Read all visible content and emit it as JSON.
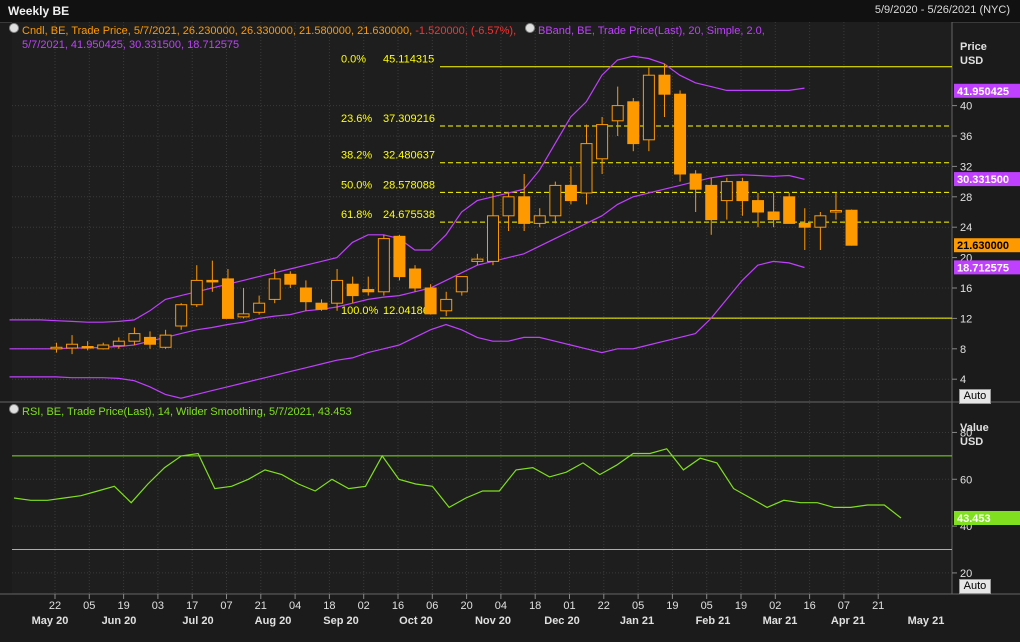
{
  "window": {
    "title": "Weekly BE",
    "date_range": "5/9/2020 - 5/26/2021 (NYC)"
  },
  "colors": {
    "candle": "#ff9900",
    "bband": "#c040ff",
    "fib": "#ffff00",
    "rsi": "#80e020",
    "grid": "#3a3a3a",
    "axis_text": "#e0e0e0",
    "last_price_label": "#ff9900",
    "rsi_label": "#80e020"
  },
  "price_panel": {
    "candle_legend": {
      "icon": "info-icon",
      "prefix": "Cndl, BE, Trade Price, 5/7/2021, 26.230000, 26.330000, 21.580000, 21.630000, ",
      "change": "-1.520000, (-6.57%),",
      "line2": "5/7/2021, 41.950425, 30.331500, 18.712575"
    },
    "bband_legend": {
      "icon": "info-icon",
      "text": "BBand, BE, Trade Price(Last),  20, Simple, 2.0,"
    },
    "axis_title": "Price",
    "axis_unit": "USD",
    "auto_label": "Auto",
    "upper_band_label": "41.950425",
    "mid_band_label": "30.331500",
    "last_price_label": "21.630000",
    "lower_band_label": "18.712575"
  },
  "rsi_panel": {
    "legend": {
      "icon": "info-icon",
      "text": "RSI, BE, Trade Price(Last),  14, Wilder Smoothing, 5/7/2021, 43.453"
    },
    "axis_title": "Value",
    "axis_unit": "USD",
    "auto_label": "Auto",
    "value_label": "43.453"
  },
  "x_axis": {
    "week_ticks": [
      "22",
      "05",
      "19",
      "03",
      "17",
      "07",
      "21",
      "04",
      "18",
      "02",
      "16",
      "06",
      "20",
      "04",
      "18",
      "01",
      "22",
      "05",
      "19",
      "05",
      "19",
      "02",
      "16",
      "07",
      "21"
    ],
    "month_labels": [
      "May 20",
      "Jun 20",
      "Jul 20",
      "Aug 20",
      "Sep 20",
      "Oct 20",
      "Nov 20",
      "Dec 20",
      "Jan 21",
      "Feb 21",
      "Mar 21",
      "Apr 21",
      "May 21"
    ]
  },
  "chart_data": [
    {
      "type": "candlestick",
      "name": "Cndl",
      "ylim": [
        1,
        51
      ],
      "y_ticks": [
        4,
        8,
        12,
        16,
        20,
        24,
        28,
        32,
        36,
        40
      ],
      "grid": true,
      "candles": [
        {
          "o": 8.0,
          "h": 8.8,
          "l": 7.5,
          "c": 8.2
        },
        {
          "o": 8.1,
          "h": 9.8,
          "l": 7.3,
          "c": 8.6
        },
        {
          "o": 8.3,
          "h": 9.0,
          "l": 7.8,
          "c": 8.1
        },
        {
          "o": 8.0,
          "h": 8.8,
          "l": 7.9,
          "c": 8.5
        },
        {
          "o": 8.4,
          "h": 9.5,
          "l": 8.0,
          "c": 9.0
        },
        {
          "o": 9.0,
          "h": 10.8,
          "l": 8.5,
          "c": 10.0
        },
        {
          "o": 9.5,
          "h": 10.3,
          "l": 8.0,
          "c": 8.6
        },
        {
          "o": 8.2,
          "h": 10.5,
          "l": 8.0,
          "c": 9.8
        },
        {
          "o": 11.0,
          "h": 14.0,
          "l": 10.5,
          "c": 13.8
        },
        {
          "o": 13.8,
          "h": 19.0,
          "l": 13.5,
          "c": 17.0
        },
        {
          "o": 17.0,
          "h": 19.6,
          "l": 15.5,
          "c": 16.8
        },
        {
          "o": 17.2,
          "h": 18.5,
          "l": 12.5,
          "c": 12.0
        },
        {
          "o": 12.2,
          "h": 16.0,
          "l": 12.0,
          "c": 12.6
        },
        {
          "o": 12.8,
          "h": 15.0,
          "l": 12.5,
          "c": 14.0
        },
        {
          "o": 14.5,
          "h": 18.5,
          "l": 14.0,
          "c": 17.2
        },
        {
          "o": 17.8,
          "h": 18.2,
          "l": 16.0,
          "c": 16.5
        },
        {
          "o": 16.0,
          "h": 17.0,
          "l": 13.0,
          "c": 14.2
        },
        {
          "o": 14.0,
          "h": 14.5,
          "l": 13.0,
          "c": 13.2
        },
        {
          "o": 14.0,
          "h": 18.5,
          "l": 13.0,
          "c": 17.0
        },
        {
          "o": 16.5,
          "h": 17.5,
          "l": 14.0,
          "c": 15.0
        },
        {
          "o": 15.8,
          "h": 17.5,
          "l": 15.0,
          "c": 15.5
        },
        {
          "o": 15.5,
          "h": 23.0,
          "l": 15.0,
          "c": 22.5
        },
        {
          "o": 22.8,
          "h": 23.0,
          "l": 17.0,
          "c": 17.5
        },
        {
          "o": 18.5,
          "h": 19.0,
          "l": 15.5,
          "c": 16.0
        },
        {
          "o": 16.0,
          "h": 16.5,
          "l": 12.5,
          "c": 12.6
        },
        {
          "o": 13.0,
          "h": 15.5,
          "l": 12.3,
          "c": 14.5
        },
        {
          "o": 15.5,
          "h": 17.5,
          "l": 15.0,
          "c": 17.5
        },
        {
          "o": 19.5,
          "h": 20.5,
          "l": 19.0,
          "c": 19.8
        },
        {
          "o": 19.5,
          "h": 28.5,
          "l": 19.0,
          "c": 25.5
        },
        {
          "o": 25.5,
          "h": 28.5,
          "l": 23.5,
          "c": 28.0
        },
        {
          "o": 28.0,
          "h": 31.0,
          "l": 23.5,
          "c": 24.5
        },
        {
          "o": 24.5,
          "h": 26.5,
          "l": 24.0,
          "c": 25.5
        },
        {
          "o": 25.5,
          "h": 30.0,
          "l": 24.5,
          "c": 29.5
        },
        {
          "o": 29.5,
          "h": 32.0,
          "l": 27.0,
          "c": 27.5
        },
        {
          "o": 28.5,
          "h": 37.5,
          "l": 27.0,
          "c": 35.0
        },
        {
          "o": 33.0,
          "h": 38.5,
          "l": 31.0,
          "c": 37.5
        },
        {
          "o": 38.0,
          "h": 42.5,
          "l": 36.0,
          "c": 40.0
        },
        {
          "o": 40.5,
          "h": 41.0,
          "l": 34.0,
          "c": 35.0
        },
        {
          "o": 35.5,
          "h": 45.0,
          "l": 34.0,
          "c": 44.0
        },
        {
          "o": 44.0,
          "h": 45.5,
          "l": 38.5,
          "c": 41.5
        },
        {
          "o": 41.5,
          "h": 42.0,
          "l": 30.0,
          "c": 31.0
        },
        {
          "o": 31.0,
          "h": 31.5,
          "l": 26.0,
          "c": 29.0
        },
        {
          "o": 29.5,
          "h": 30.5,
          "l": 23.0,
          "c": 25.0
        },
        {
          "o": 27.5,
          "h": 30.5,
          "l": 25.0,
          "c": 30.0
        },
        {
          "o": 30.0,
          "h": 30.5,
          "l": 25.5,
          "c": 27.5
        },
        {
          "o": 27.5,
          "h": 28.5,
          "l": 24.0,
          "c": 26.0
        },
        {
          "o": 26.0,
          "h": 28.5,
          "l": 24.0,
          "c": 25.0
        },
        {
          "o": 28.0,
          "h": 28.5,
          "l": 24.5,
          "c": 24.5
        },
        {
          "o": 24.5,
          "h": 26.5,
          "l": 21.0,
          "c": 24.0
        },
        {
          "o": 24.0,
          "h": 26.0,
          "l": 21.0,
          "c": 25.5
        },
        {
          "o": 26.0,
          "h": 28.5,
          "l": 25.0,
          "c": 26.2
        },
        {
          "o": 26.23,
          "h": 26.33,
          "l": 21.58,
          "c": 21.63
        }
      ],
      "bollinger": {
        "upper": [
          11.8,
          11.8,
          11.8,
          11.7,
          11.6,
          11.5,
          11.5,
          11.6,
          11.8,
          13.0,
          14.5,
          15.0,
          15.5,
          16.0,
          16.5,
          17.0,
          17.5,
          18.0,
          18.5,
          19.0,
          19.5,
          20.0,
          22.0,
          23.0,
          23.0,
          22.5,
          21.0,
          21.0,
          23.0,
          26.0,
          27.5,
          28.0,
          28.5,
          29.0,
          31.5,
          35.0,
          38.5,
          40.5,
          44.0,
          46.0,
          46.5,
          46.2,
          45.5,
          44.0,
          43.0,
          42.5,
          42.0,
          42.0,
          42.0,
          42.0,
          42.0,
          42.3
        ],
        "mid": [
          8.0,
          8.0,
          8.0,
          8.0,
          8.1,
          8.1,
          8.2,
          8.3,
          8.5,
          9.0,
          9.5,
          10.0,
          10.5,
          10.8,
          11.2,
          11.5,
          12.0,
          12.3,
          12.5,
          13.0,
          13.2,
          13.5,
          14.0,
          14.5,
          14.8,
          15.0,
          15.5,
          16.0,
          17.0,
          18.0,
          19.0,
          19.5,
          20.0,
          20.5,
          21.5,
          22.5,
          23.5,
          24.5,
          25.5,
          27.0,
          28.0,
          28.5,
          29.0,
          29.5,
          30.0,
          30.5,
          30.8,
          30.9,
          30.8,
          30.7,
          30.8,
          30.3
        ],
        "lower": [
          4.3,
          4.3,
          4.3,
          4.3,
          4.2,
          4.2,
          4.2,
          4.1,
          3.8,
          3.0,
          2.0,
          1.5,
          2.0,
          2.5,
          3.0,
          3.5,
          4.0,
          4.5,
          5.0,
          5.5,
          6.0,
          6.5,
          6.8,
          7.5,
          8.0,
          8.5,
          9.5,
          10.5,
          11.2,
          10.5,
          9.5,
          9.0,
          9.0,
          9.5,
          9.5,
          9.0,
          8.5,
          8.0,
          7.5,
          8.0,
          8.0,
          8.5,
          9.0,
          9.5,
          10.0,
          12.0,
          14.5,
          17.0,
          19.0,
          19.5,
          19.3,
          18.7
        ]
      },
      "fibonacci": [
        {
          "pct": "0.0%",
          "value": "45.114315",
          "y": 45.114315
        },
        {
          "pct": "23.6%",
          "value": "37.309216",
          "y": 37.309216
        },
        {
          "pct": "38.2%",
          "value": "32.480637",
          "y": 32.480637
        },
        {
          "pct": "50.0%",
          "value": "28.578088",
          "y": 28.578088
        },
        {
          "pct": "61.8%",
          "value": "24.675538",
          "y": 24.675538
        },
        {
          "pct": "100.0%",
          "value": "12.041861",
          "y": 12.041861
        }
      ]
    },
    {
      "type": "line",
      "name": "RSI",
      "ylim": [
        11,
        93
      ],
      "y_ticks": [
        20,
        40,
        60,
        80
      ],
      "bands": [
        30,
        70
      ],
      "values": [
        52,
        51,
        51,
        52,
        53,
        55,
        57,
        50,
        58,
        65,
        70,
        71,
        56,
        57,
        60,
        64,
        62,
        58,
        55,
        60,
        56,
        57,
        70,
        60,
        58,
        57,
        48,
        52,
        55,
        55,
        64,
        65,
        61,
        63,
        67,
        62,
        66,
        71,
        71,
        73,
        64,
        69,
        67,
        56,
        52,
        48,
        51,
        50,
        50,
        48,
        48,
        49,
        49,
        43.453
      ]
    }
  ]
}
